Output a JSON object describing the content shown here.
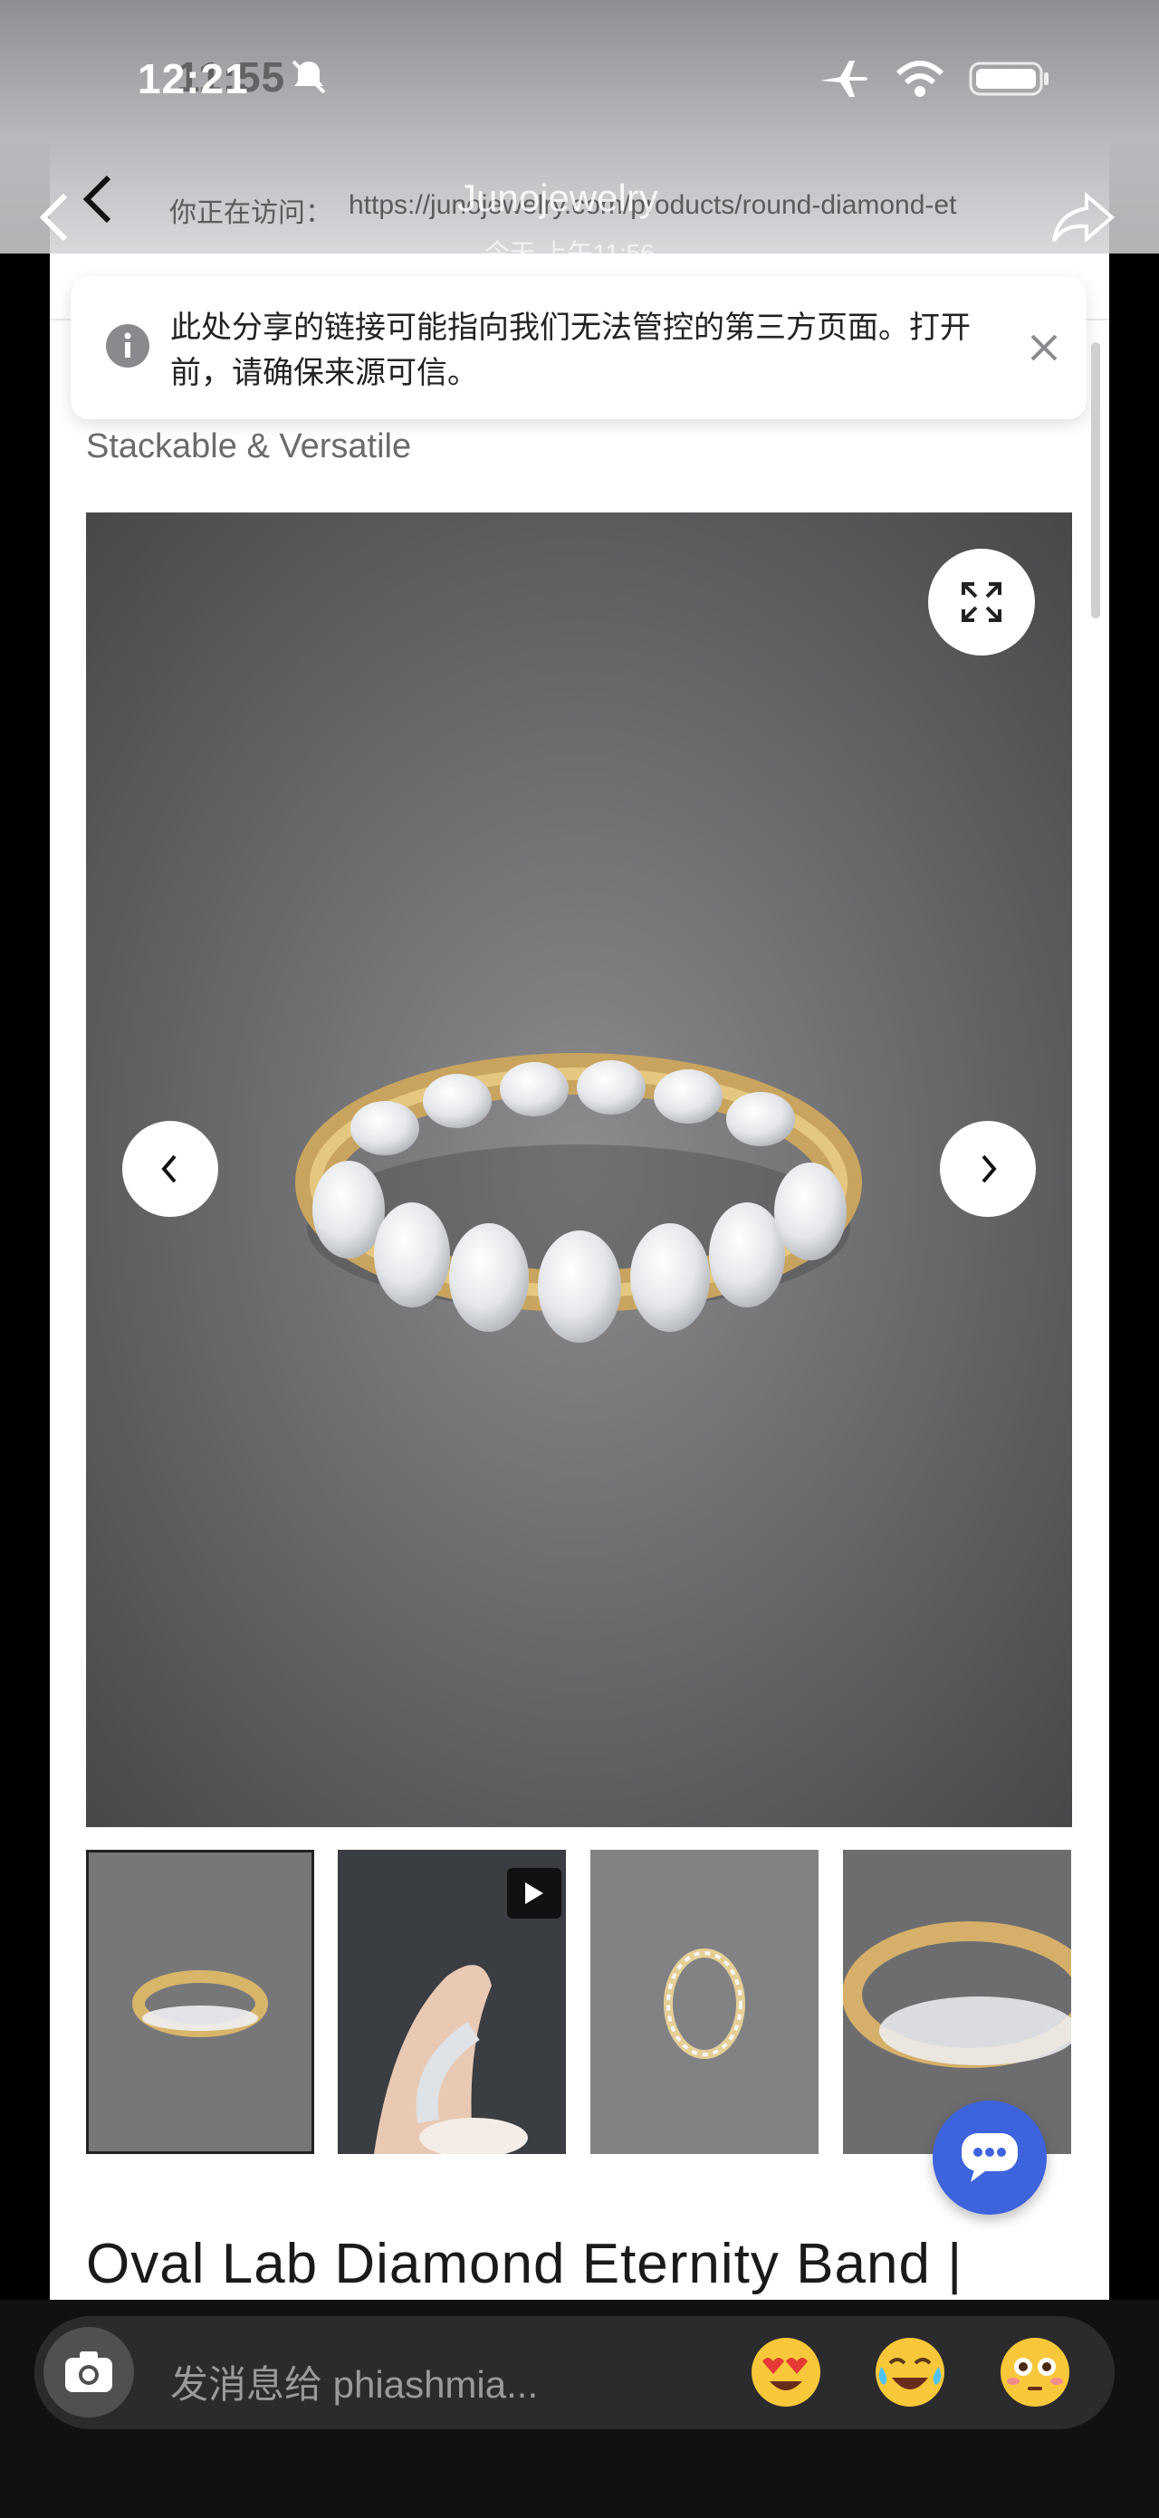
{
  "status_bar": {
    "time_front": "12:21",
    "time_back": "11:55"
  },
  "share_preview": {
    "sender": "Junojewelry",
    "time": "今天 上午11:56",
    "visiting_label": "你正在访问：",
    "url": "https://junojewelry.com/products/round-diamond-et"
  },
  "warning": {
    "text": "此处分享的链接可能指向我们无法管控的第三方页面。打开前，请确保来源可信。"
  },
  "page": {
    "tagline": "Stackable & Versatile",
    "product_title": "Oval Lab Diamond Eternity Band |"
  },
  "gallery": {
    "thumbnails": [
      "ring-on-fabric",
      "ring-in-hand-video",
      "ring-top-view",
      "ring-closeup"
    ]
  },
  "composer": {
    "placeholder": "发消息给 phiashmia...",
    "emojis": [
      "heart-eyes",
      "tears-of-joy",
      "flushed"
    ]
  },
  "colors": {
    "chat_button": "#3d63dd",
    "gold": "#d9b56a",
    "background_fabric": "#6f6f72"
  }
}
